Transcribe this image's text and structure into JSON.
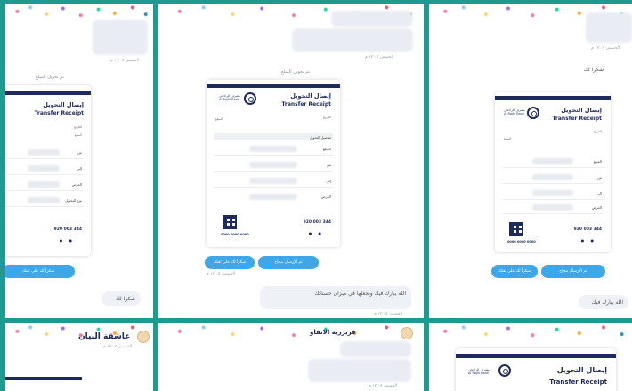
{
  "colors": {
    "frame": "#1f9a93",
    "receipt_dark": "#1e2a5a",
    "button": "#3fa7e8",
    "bubble": "#eef1f6"
  },
  "receipt": {
    "title_ar": "إيصال التحويل",
    "title_en": "Transfer Receipt",
    "bank_line1": "مصرف الراجحي",
    "bank_line2": "Al Rajhi Bank",
    "date_label": "التاريخ",
    "amount_label": "المبلغ",
    "from_label": "من",
    "to_label": "إلى",
    "purpose_label": "الغرض",
    "transfer_type_label": "نوع التحويل",
    "header_label_ar": "تفاصيل التحويل",
    "phone": "920 003 344",
    "code": "0000 0000 0000",
    "social": "● ●",
    "logo_icon": "bank-logo-icon"
  },
  "buttons": {
    "confirm": "تم الإرسال بنجاح",
    "thanks": "شكراً لك على ثقتك"
  },
  "messages": {
    "system_sent": "تم تحويل المبلغ",
    "thanks_reply": "الله يبارك فيك",
    "bless_msg": "الله يبارك فيك ويجعلها في ميزان حسناتك",
    "short_reply": "شكرا لك",
    "timestamp": "الخميس ١٢:٠٥ م"
  },
  "tiles": {
    "bottom_left_name": "عاشقة البيان",
    "bottom_mid_name": "فريزرية الانفاو"
  }
}
